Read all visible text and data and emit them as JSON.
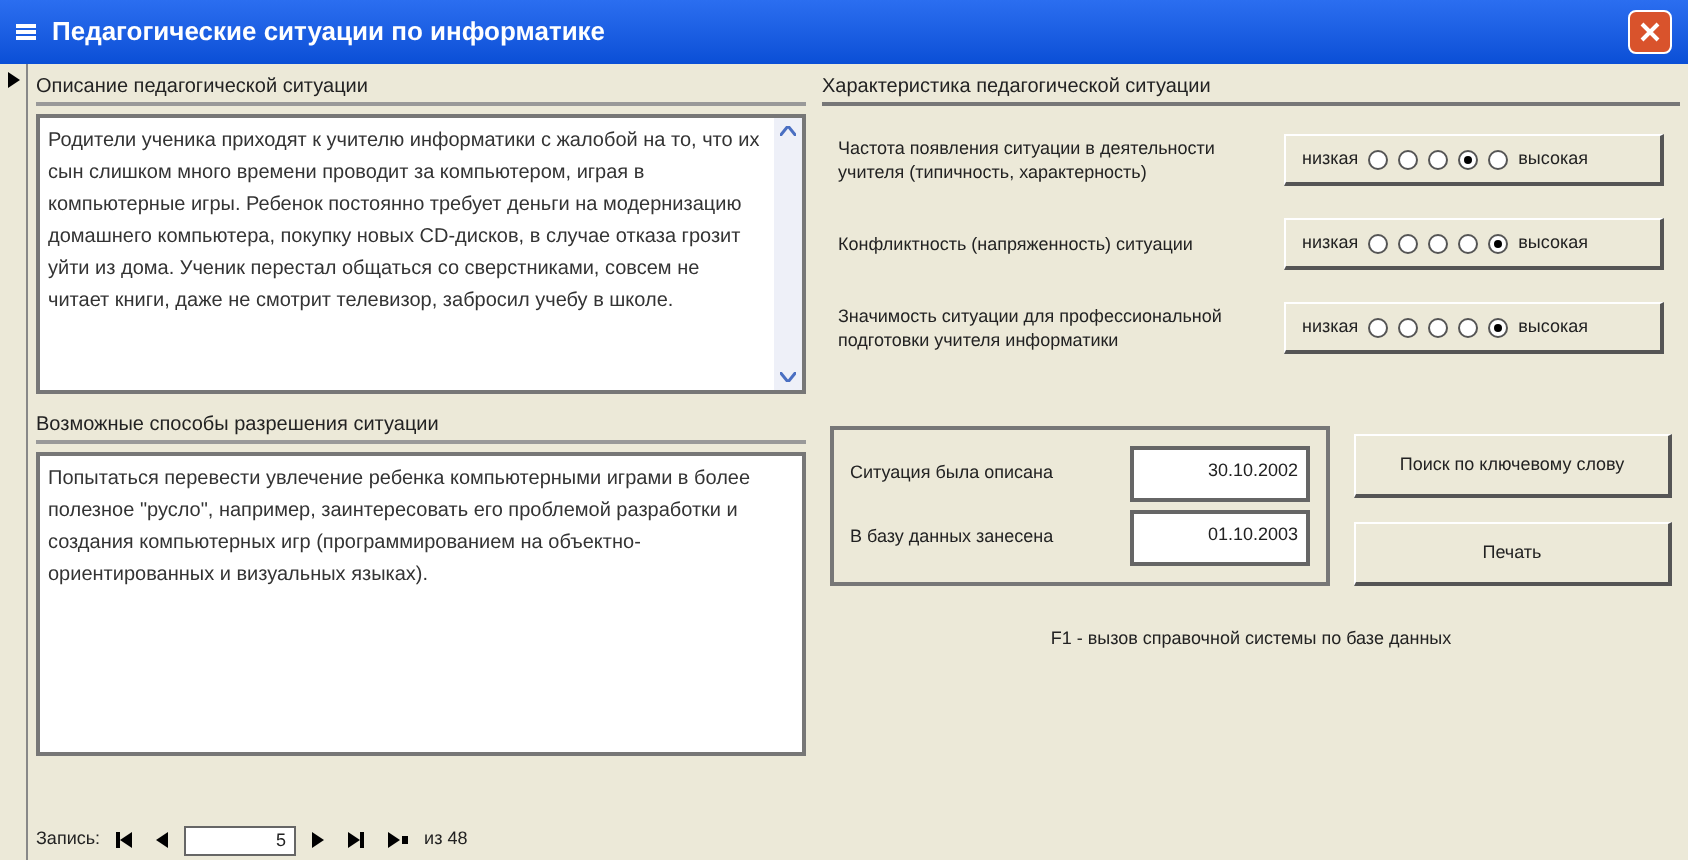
{
  "window": {
    "title": "Педагогические ситуации по информатике"
  },
  "description": {
    "label": "Описание педагогической ситуации",
    "text": "Родители ученика приходят к учителю информатики с жалобой на то, что их сын слишком много времени проводит за компьютером, играя в компьютерные игры. Ребенок постоянно требует деньги на модернизацию домашнего компьютера, покупку новых CD-дисков, в случае отказа грозит уйти из дома. Ученик перестал общаться со сверстниками, совсем не читает книги, даже не смотрит телевизор, забросил учебу в школе."
  },
  "solutions": {
    "label": "Возможные способы разрешения ситуации",
    "text": "Попытаться перевести увлечение ребенка компьютерными играми в более полезное \"русло\", например, заинтересовать его проблемой разработки и создания компьютерных игр (программированием на объектно-ориентированных и визуальных языках)."
  },
  "characteristics": {
    "label": "Характеристика педагогической ситуации",
    "rows": [
      {
        "label": "Частота появления ситуации в деятельности учителя (типичность, характерность)",
        "low": "низкая",
        "high": "высокая",
        "options": [
          {
            "selected": false
          },
          {
            "selected": false
          },
          {
            "selected": false
          },
          {
            "selected": true
          },
          {
            "selected": false
          }
        ]
      },
      {
        "label": "Конфликтность (напряженность) ситуации",
        "low": "низкая",
        "high": "высокая",
        "options": [
          {
            "selected": false
          },
          {
            "selected": false
          },
          {
            "selected": false
          },
          {
            "selected": false
          },
          {
            "selected": true
          }
        ]
      },
      {
        "label": "Значимость ситуации для профессиональной подготовки учителя информатики",
        "low": "низкая",
        "high": "высокая",
        "options": [
          {
            "selected": false
          },
          {
            "selected": false
          },
          {
            "selected": false
          },
          {
            "selected": false
          },
          {
            "selected": true
          }
        ]
      }
    ]
  },
  "dates": [
    {
      "label": "Ситуация была описана",
      "value": "30.10.2002"
    },
    {
      "label": "В базу данных занесена",
      "value": "01.10.2003"
    }
  ],
  "buttons": [
    "Поиск по ключевому слову",
    "Печать"
  ],
  "hint": "F1 - вызов справочной системы по базе данных",
  "navigator": {
    "label": "Запись:",
    "record": "5",
    "total": "из 48"
  }
}
